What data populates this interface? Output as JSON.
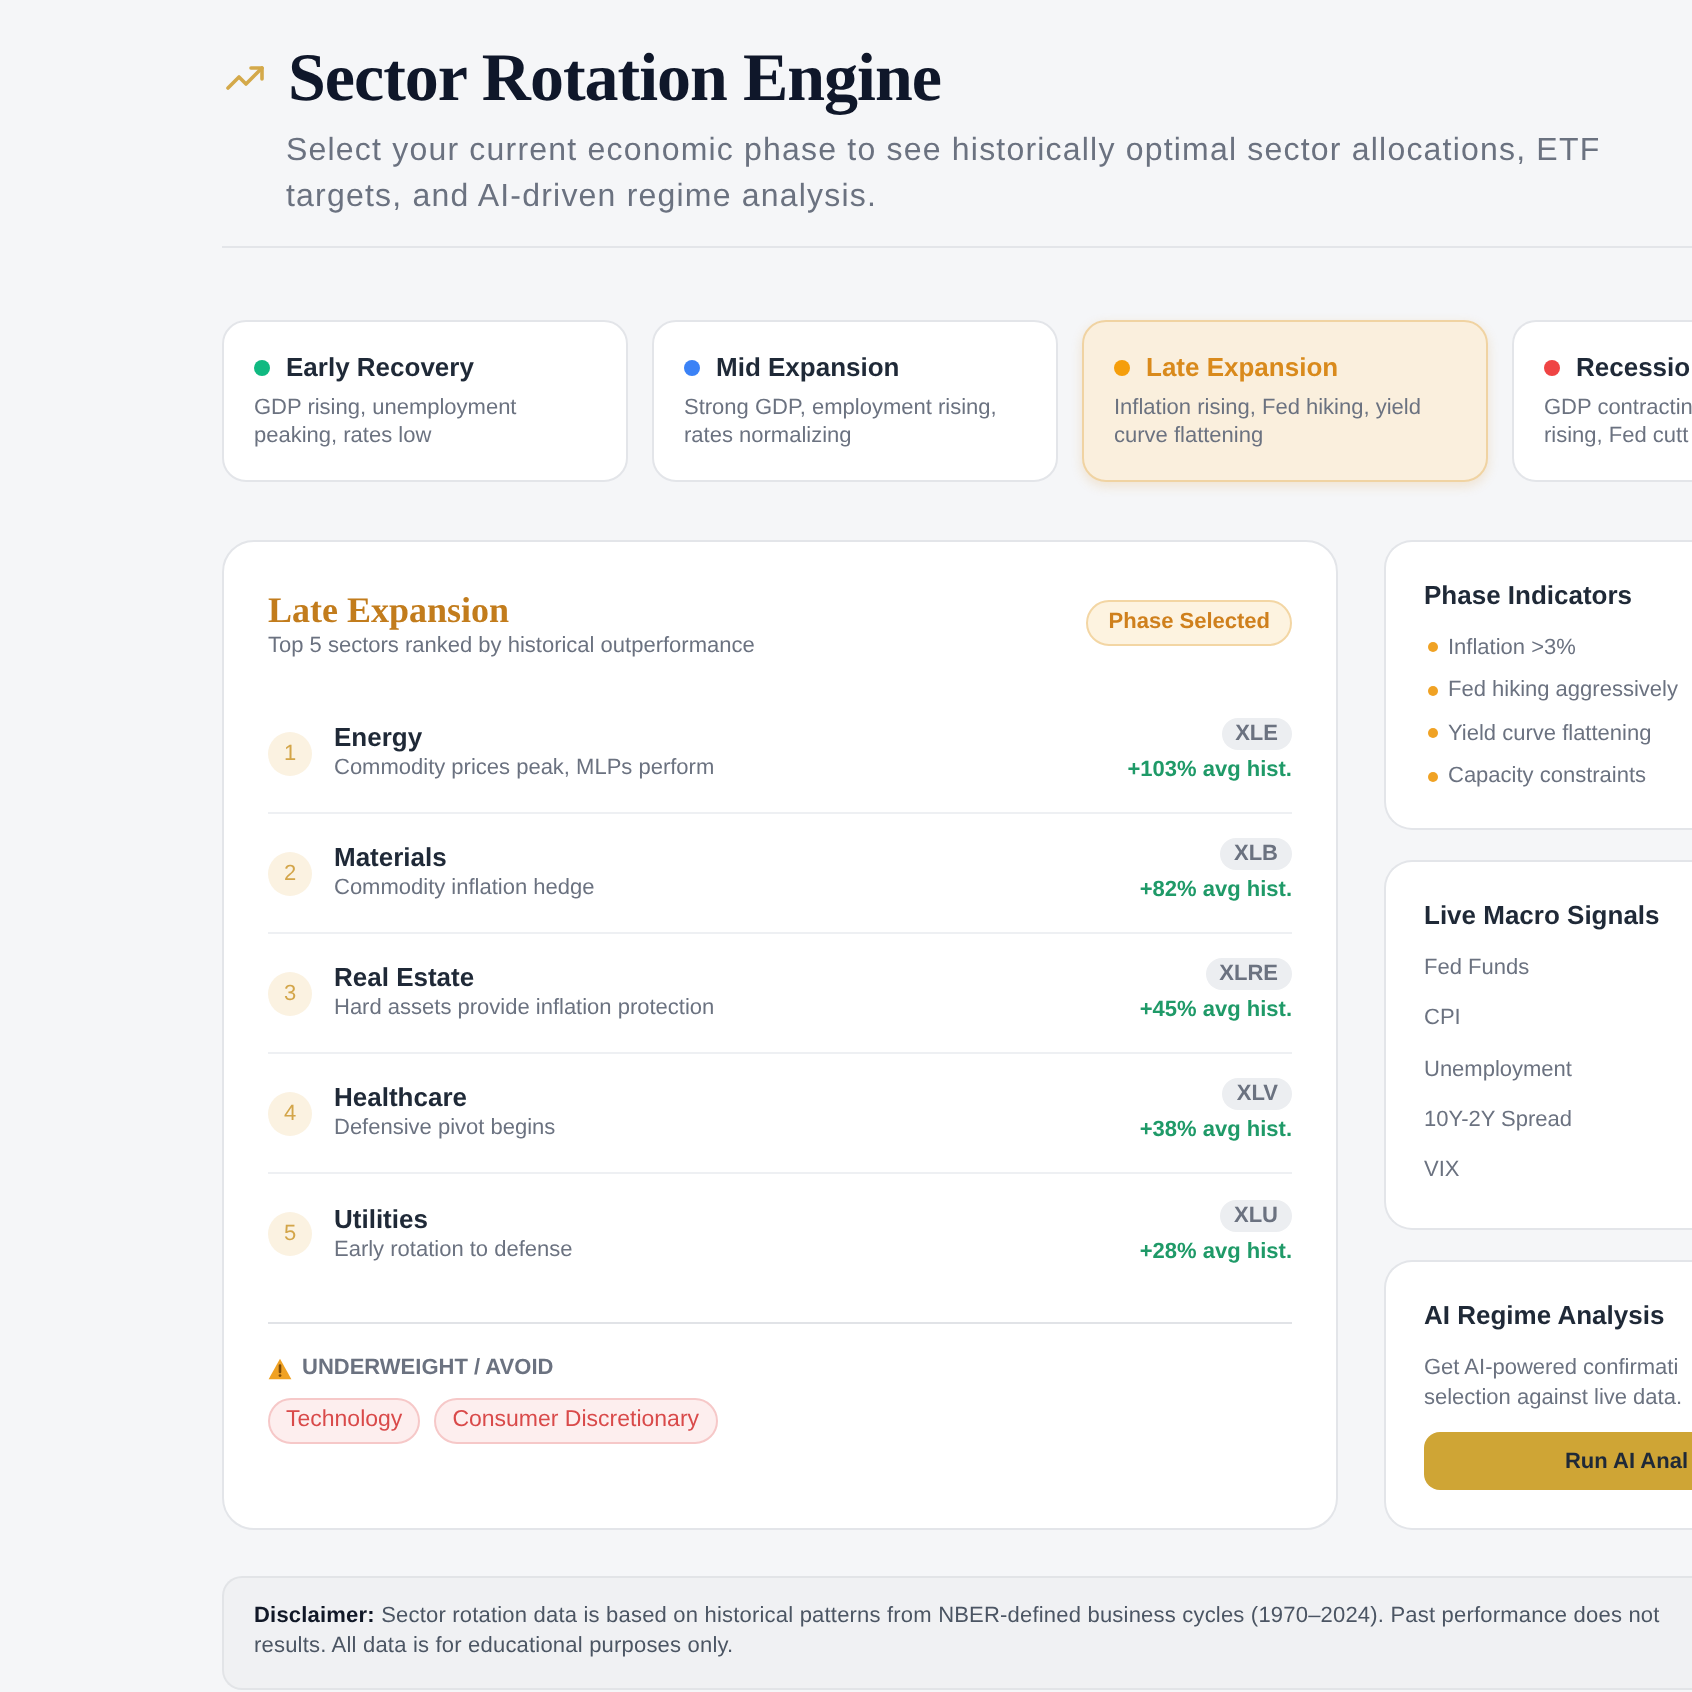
{
  "header": {
    "title": "Sector Rotation Engine",
    "subtitle_lines": [
      "Select your current economic phase to see historically optimal sector allocations, ETF",
      "targets, and AI-driven regime analysis."
    ]
  },
  "phases": [
    {
      "name": "Early Recovery",
      "description_lines": [
        "GDP rising, unemployment",
        "peaking, rates low"
      ],
      "color": "#10b981",
      "selected": false
    },
    {
      "name": "Mid Expansion",
      "description_lines": [
        "Strong GDP, employment rising,",
        "rates normalizing"
      ],
      "color": "#3b82f6",
      "selected": false
    },
    {
      "name": "Late Expansion",
      "description_lines": [
        "Inflation rising, Fed hiking, yield",
        "curve flattening"
      ],
      "color": "#f59e0b",
      "selected": true
    },
    {
      "name": "Recessio",
      "description_lines": [
        "GDP contractin",
        "rising, Fed cutt"
      ],
      "color": "#ef4444",
      "selected": false
    }
  ],
  "allocation": {
    "title": "Late Expansion",
    "subtitle": "Top 5 sectors ranked by historical outperformance",
    "badge": "Phase Selected",
    "sectors": [
      {
        "rank": "1",
        "name": "Energy",
        "description": "Commodity prices peak, MLPs perform",
        "ticker": "XLE",
        "return": "+103% avg hist."
      },
      {
        "rank": "2",
        "name": "Materials",
        "description": "Commodity inflation hedge",
        "ticker": "XLB",
        "return": "+82% avg hist."
      },
      {
        "rank": "3",
        "name": "Real Estate",
        "description": "Hard assets provide inflation protection",
        "ticker": "XLRE",
        "return": "+45% avg hist."
      },
      {
        "rank": "4",
        "name": "Healthcare",
        "description": "Defensive pivot begins",
        "ticker": "XLV",
        "return": "+38% avg hist."
      },
      {
        "rank": "5",
        "name": "Utilities",
        "description": "Early rotation to defense",
        "ticker": "XLU",
        "return": "+28% avg hist."
      }
    ],
    "avoid": {
      "label": "UNDERWEIGHT / AVOID",
      "tags": [
        "Technology",
        "Consumer Discretionary"
      ]
    }
  },
  "phase_indicators": {
    "title": "Phase Indicators",
    "items": [
      "Inflation >3%",
      "Fed hiking aggressively",
      "Yield curve flattening",
      "Capacity constraints"
    ]
  },
  "macro_signals": {
    "title": "Live Macro Signals",
    "items": [
      "Fed Funds",
      "CPI",
      "Unemployment",
      "10Y-2Y Spread",
      "VIX"
    ]
  },
  "ai_analysis": {
    "title": "AI Regime Analysis",
    "description_lines": [
      "Get AI-powered confirmati",
      "selection against live data."
    ],
    "button": "Run AI Anal"
  },
  "disclaimer": {
    "lines": [
      "**Disclaimer:** Sector rotation data is based on historical patterns from NBER-defined business cycles (1970–2024). Past performance does not",
      "results. All data is for educational purposes only."
    ]
  }
}
